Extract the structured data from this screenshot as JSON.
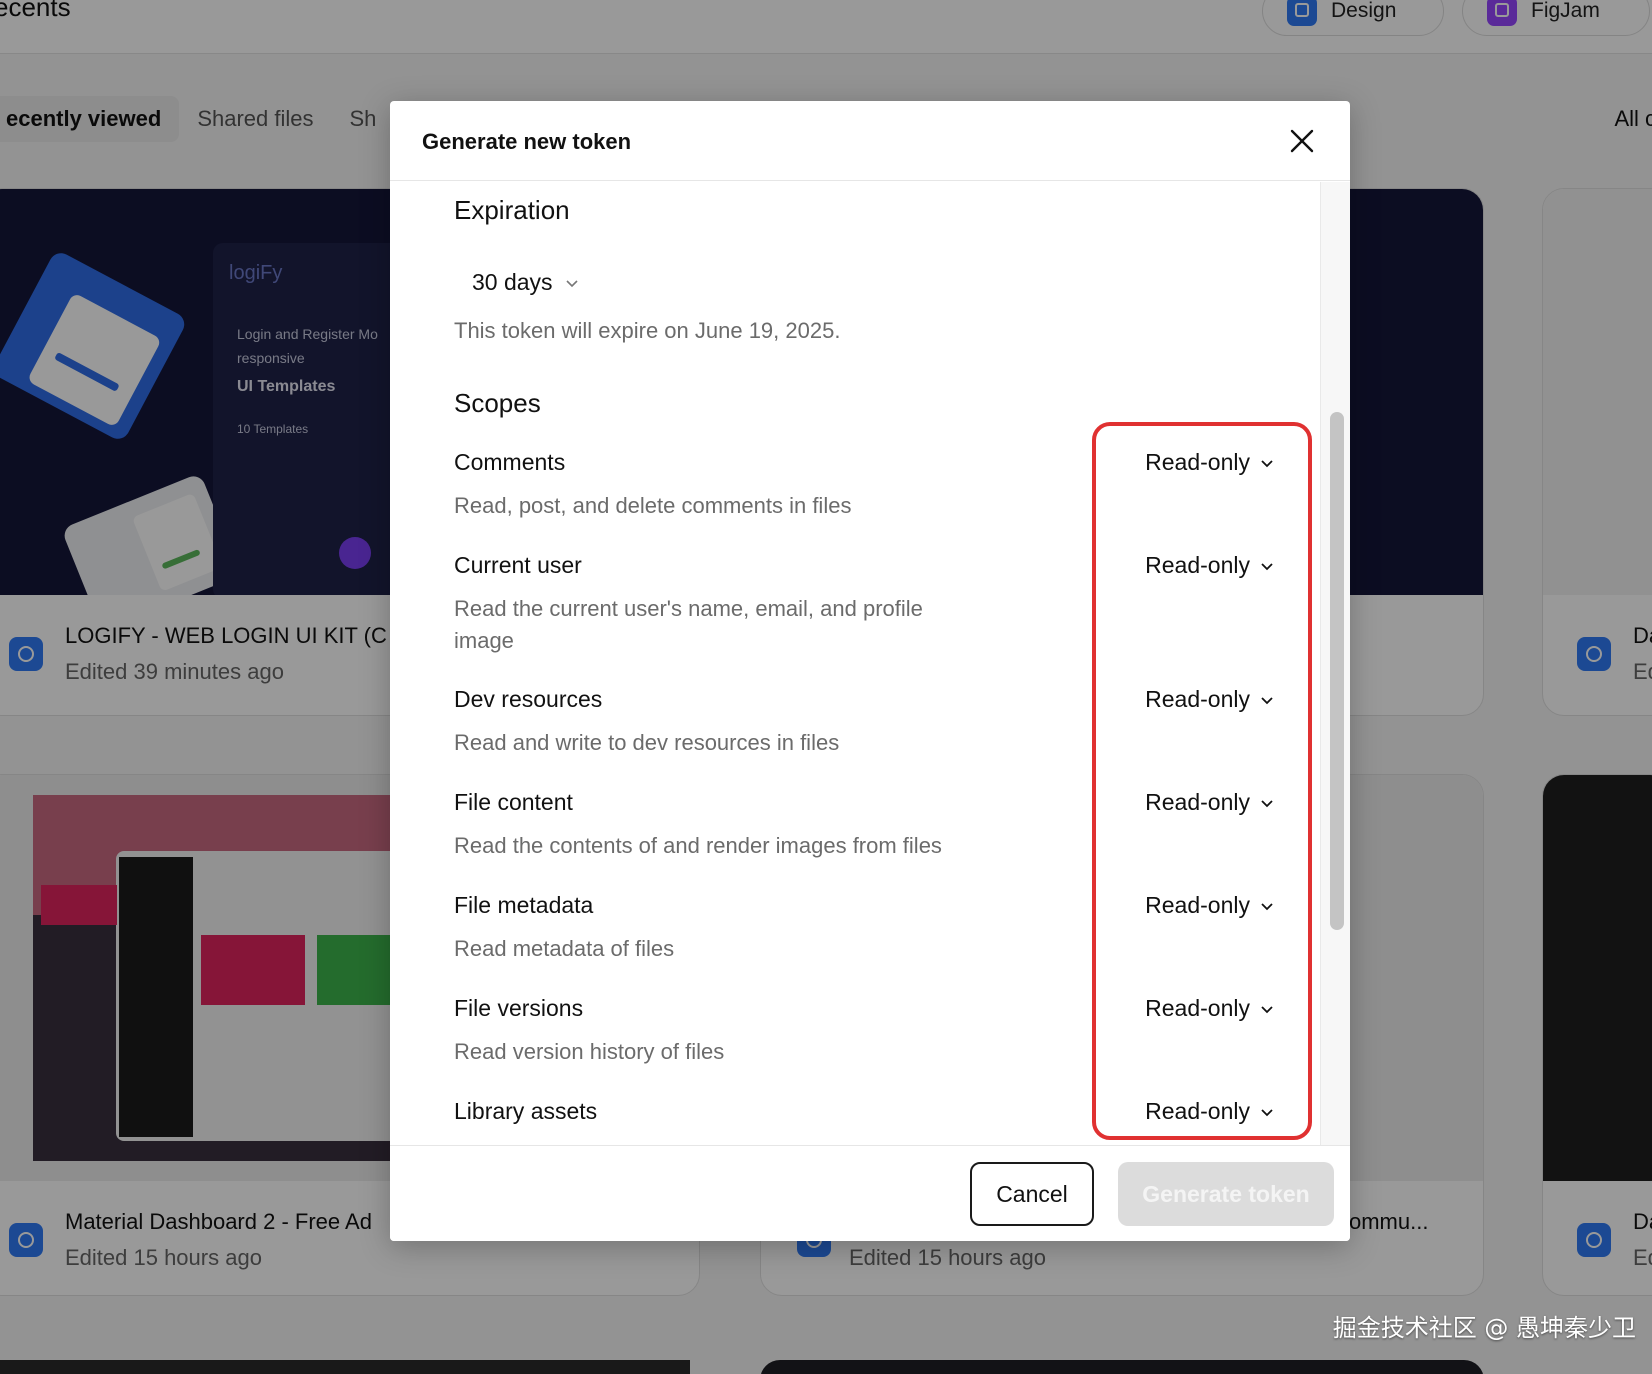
{
  "background": {
    "header_title": "ecents",
    "pills": [
      {
        "label": "Design",
        "icon": "design-icon",
        "color": "#2f7bf6"
      },
      {
        "label": "FigJam",
        "icon": "figjam-icon",
        "color": "#9747ff"
      }
    ],
    "tabs": [
      "ecently viewed",
      "Shared files",
      "Sh"
    ],
    "all_files": "All c",
    "cards": [
      {
        "title": "LOGIFY - WEB LOGIN UI KIT (C",
        "subtitle": "Edited 39 minutes ago"
      },
      {
        "title": "Material Dashboard 2 - Free Ad",
        "subtitle": "Edited 15 hours ago"
      },
      {
        "title": "ommu...",
        "subtitle": "Edited 15 hours ago"
      },
      {
        "title": "Da",
        "subtitle": "Ed"
      },
      {
        "title": "Da",
        "subtitle": "Ed"
      }
    ],
    "thumb_text": {
      "logo": "logiFy",
      "tagline": "Login and Register Mo",
      "tagline2": "responsive",
      "heading": "UI Templates",
      "count": "10 Templates"
    }
  },
  "modal": {
    "title": "Generate new token",
    "expiration": {
      "heading": "Expiration",
      "selected": "30 days",
      "note": "This token will expire on June 19, 2025."
    },
    "scopes": {
      "heading": "Scopes",
      "items": [
        {
          "name": "Comments",
          "description": "Read, post, and delete comments in files",
          "access": "Read-only"
        },
        {
          "name": "Current user",
          "description": "Read the current user's name, email, and profile image",
          "access": "Read-only"
        },
        {
          "name": "Dev resources",
          "description": "Read and write to dev resources in files",
          "access": "Read-only"
        },
        {
          "name": "File content",
          "description": "Read the contents of and render images from files",
          "access": "Read-only"
        },
        {
          "name": "File metadata",
          "description": "Read metadata of files",
          "access": "Read-only"
        },
        {
          "name": "File versions",
          "description": "Read version history of files",
          "access": "Read-only"
        },
        {
          "name": "Library assets",
          "description": "",
          "access": "Read-only"
        }
      ]
    },
    "footer": {
      "cancel_label": "Cancel",
      "generate_label": "Generate token"
    }
  },
  "watermark": "掘金技术社区 @ 愚坤秦少卫",
  "colors": {
    "highlight": "#e03131",
    "overlay": "rgba(0,0,0,0.40)",
    "disabled_button": "#dcdcdc"
  }
}
